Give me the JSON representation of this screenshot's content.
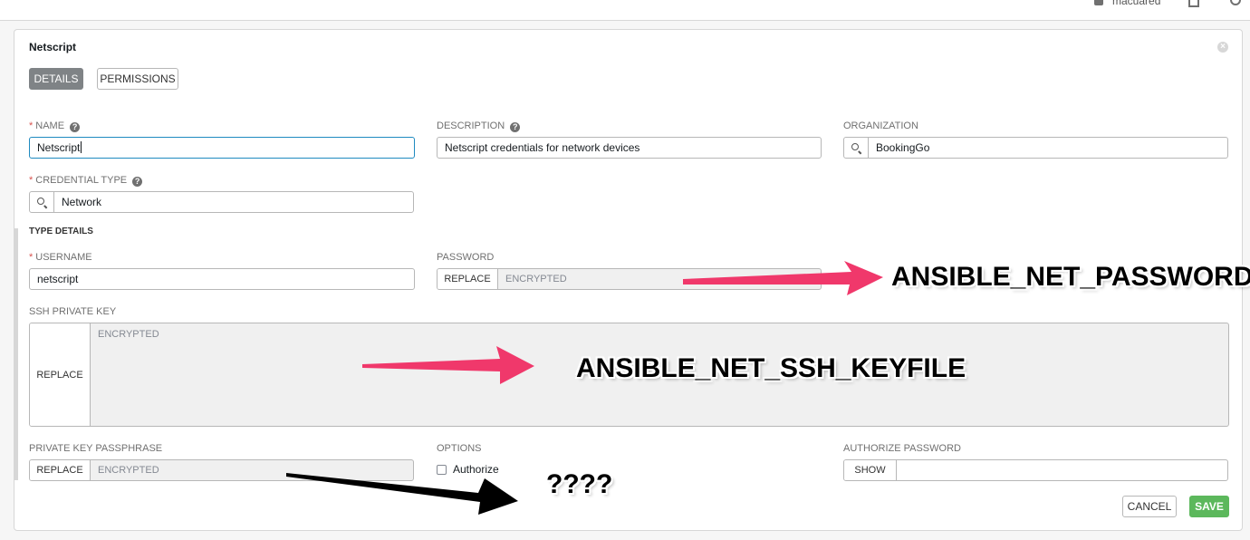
{
  "topbar": {
    "user_name": "macuared"
  },
  "form": {
    "title": "Netscript",
    "tabs": [
      {
        "label": "DETAILS",
        "active": true
      },
      {
        "label": "PERMISSIONS",
        "active": false
      }
    ],
    "name": {
      "label": "NAME",
      "required": true,
      "value": "Netscript"
    },
    "description": {
      "label": "DESCRIPTION",
      "value": "Netscript credentials for network devices"
    },
    "organization": {
      "label": "ORGANIZATION",
      "value": "BookingGo"
    },
    "credential_type": {
      "label": "CREDENTIAL TYPE",
      "required": true,
      "value": "Network"
    },
    "type_details_label": "TYPE DETAILS",
    "username": {
      "label": "USERNAME",
      "required": true,
      "value": "netscript"
    },
    "password": {
      "label": "PASSWORD",
      "button": "REPLACE",
      "value": "ENCRYPTED"
    },
    "ssh_private_key": {
      "label": "SSH PRIVATE KEY",
      "button": "REPLACE",
      "value": "ENCRYPTED"
    },
    "private_key_passphrase": {
      "label": "PRIVATE KEY PASSPHRASE",
      "button": "REPLACE",
      "value": "ENCRYPTED"
    },
    "options": {
      "label": "OPTIONS",
      "authorize_label": "Authorize",
      "authorize_checked": false
    },
    "authorize_password": {
      "label": "AUTHORIZE PASSWORD",
      "button": "SHOW",
      "value": ""
    },
    "cancel_label": "CANCEL",
    "save_label": "SAVE",
    "required_marker": "*",
    "help_glyph": "?",
    "close_glyph": "×"
  },
  "annotations": {
    "password_note": "ANSIBLE_NET_PASSWORD",
    "ssh_keyfile_note": "ANSIBLE_NET_SSH_KEYFILE",
    "unknown_note": "????",
    "arrow_color_pink": "#f0386b",
    "arrow_color_black": "#000000"
  },
  "colors": {
    "accent_blue": "#1f8ac0",
    "save_green": "#5cb85c",
    "required_red": "#d9534f",
    "active_tab": "#7f8386"
  },
  "icons": {
    "search": "search-icon",
    "help": "help-icon",
    "close": "close-icon"
  }
}
